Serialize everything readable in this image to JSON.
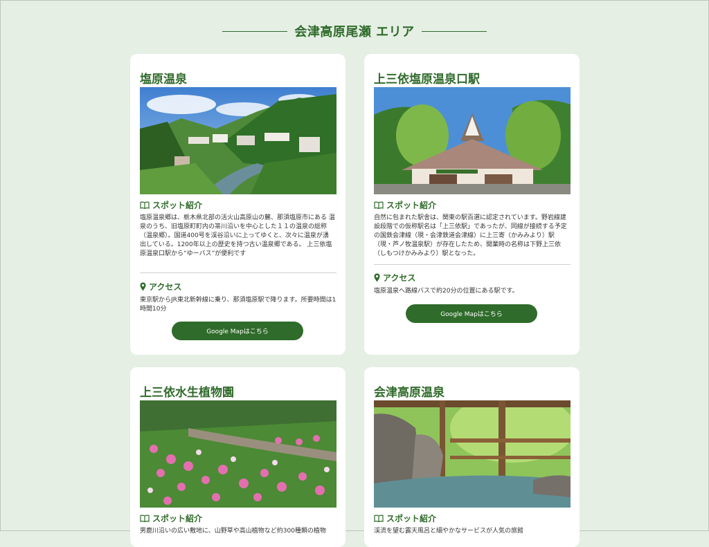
{
  "section": {
    "title": "会津高原尾瀬 エリア"
  },
  "cards": [
    {
      "title": "塩原温泉",
      "spot_label": "スポット紹介",
      "spot_text": "塩原温泉郷は、栃木県北部の活火山高原山の麓、那須塩原市にある 温泉のうち、旧塩原町町内の箒川沿いを中心とした１１の温泉の総称（温泉郷）。国道400号を渓谷沿いに上ってゆくと、次々に温泉が湧 出している。1200年以上の歴史を持つ古い温泉郷である。 上三依塩原温泉口駅から“ゆーバス”が便利です",
      "access_label": "アクセス",
      "access_text": "東京駅からJR東北新幹線に乗り、那須塩原駅で降ります。所要時間は1時間10分",
      "button": "Google Mapはこちら"
    },
    {
      "title": "上三依塩原温泉口駅",
      "spot_label": "スポット紹介",
      "spot_text": "自然に包まれた駅舎は、関東の駅百選に認定されています。野岩線建設段階での仮称駅名は「上三依駅」であったが、同線が接続する予定の国鉄会津線（現・会津鉄道会津線）に上三寄（かみみより）駅（現・芦ノ牧温泉駅）が存在したため、開業時の名称は下野上三依（しもつけかみみより）駅となった。",
      "access_label": "アクセス",
      "access_text": "塩原温泉へ路線バスで約20分の位置にある駅です。",
      "button": "Google Mapはこちら"
    },
    {
      "title": "上三依水生植物園",
      "spot_label": "スポット紹介",
      "spot_text": "男鹿川沿いの広い敷地に、山野草や高山植物など約300種類の植物"
    },
    {
      "title": "会津高原温泉",
      "spot_label": "スポット紹介",
      "spot_text": "渓流を望む露天風呂と細やかなサービスが人気の旅館",
      "note": ""
    }
  ],
  "colors": {
    "accent": "#2f6b2a",
    "background": "#e5efe4",
    "card": "#ffffff"
  },
  "icons": {
    "spot": "book-open-icon",
    "access": "map-pin-icon"
  }
}
